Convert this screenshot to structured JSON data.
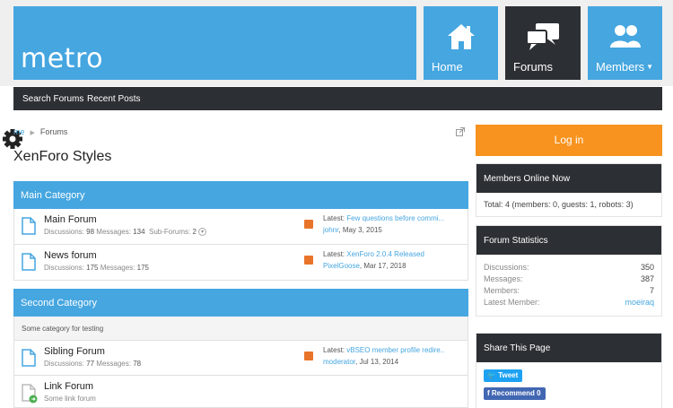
{
  "header": {
    "logo": "metro",
    "tiles": [
      {
        "label": "Home",
        "icon": "home-icon"
      },
      {
        "label": "Forums",
        "icon": "chat-bubbles-icon"
      },
      {
        "label": "Members",
        "icon": "users-icon"
      }
    ],
    "members_caret": "▼"
  },
  "subnav": {
    "items": [
      "Search Forums",
      "Recent Posts"
    ]
  },
  "breadcrumb": {
    "home": "me",
    "current": "Forums"
  },
  "page_title": "XenForo Styles",
  "categories": [
    {
      "title": "Main Category",
      "description": "",
      "forums": [
        {
          "title": "Main Forum",
          "discussions_label": "Discussions:",
          "discussions": "98",
          "messages_label": "Messages:",
          "messages": "134",
          "subforums_label": "Sub-Forums:",
          "subforums": "2",
          "latest_label": "Latest:",
          "latest_title": "Few questions before commi...",
          "latest_user": "johnr",
          "latest_date": "May 3, 2015"
        },
        {
          "title": "News forum",
          "discussions_label": "Discussions:",
          "discussions": "175",
          "messages_label": "Messages:",
          "messages": "175",
          "latest_label": "Latest:",
          "latest_title": "XenForo 2.0.4 Released",
          "latest_user": "PixelGoose",
          "latest_date": "Mar 17, 2018"
        }
      ]
    },
    {
      "title": "Second Category",
      "description": "Some category for testing",
      "forums": [
        {
          "title": "Sibling Forum",
          "discussions_label": "Discussions:",
          "discussions": "77",
          "messages_label": "Messages:",
          "messages": "78",
          "latest_label": "Latest:",
          "latest_title": "vBSEO member profile redire..",
          "latest_user": "moderator",
          "latest_date": "Jul 13, 2014"
        },
        {
          "title": "Link Forum",
          "subtitle": "Some link forum"
        }
      ]
    }
  ],
  "sidebar": {
    "login_label": "Log in",
    "members_online": {
      "title": "Members Online Now",
      "text": "Total: 4 (members: 0, guests: 1, robots: 3)"
    },
    "forum_stats": {
      "title": "Forum Statistics",
      "rows": [
        {
          "label": "Discussions:",
          "value": "350"
        },
        {
          "label": "Messages:",
          "value": "387"
        },
        {
          "label": "Members:",
          "value": "7"
        },
        {
          "label": "Latest Member:",
          "value": "moeiraq"
        }
      ]
    },
    "share": {
      "title": "Share This Page",
      "tweet": "Tweet",
      "recommend": "Recommend 0"
    }
  },
  "colors": {
    "accent": "#45a6e0",
    "dark": "#2c2f33",
    "orange": "#f7931e",
    "twitter": "#1da1f2",
    "facebook": "#4267b2"
  }
}
